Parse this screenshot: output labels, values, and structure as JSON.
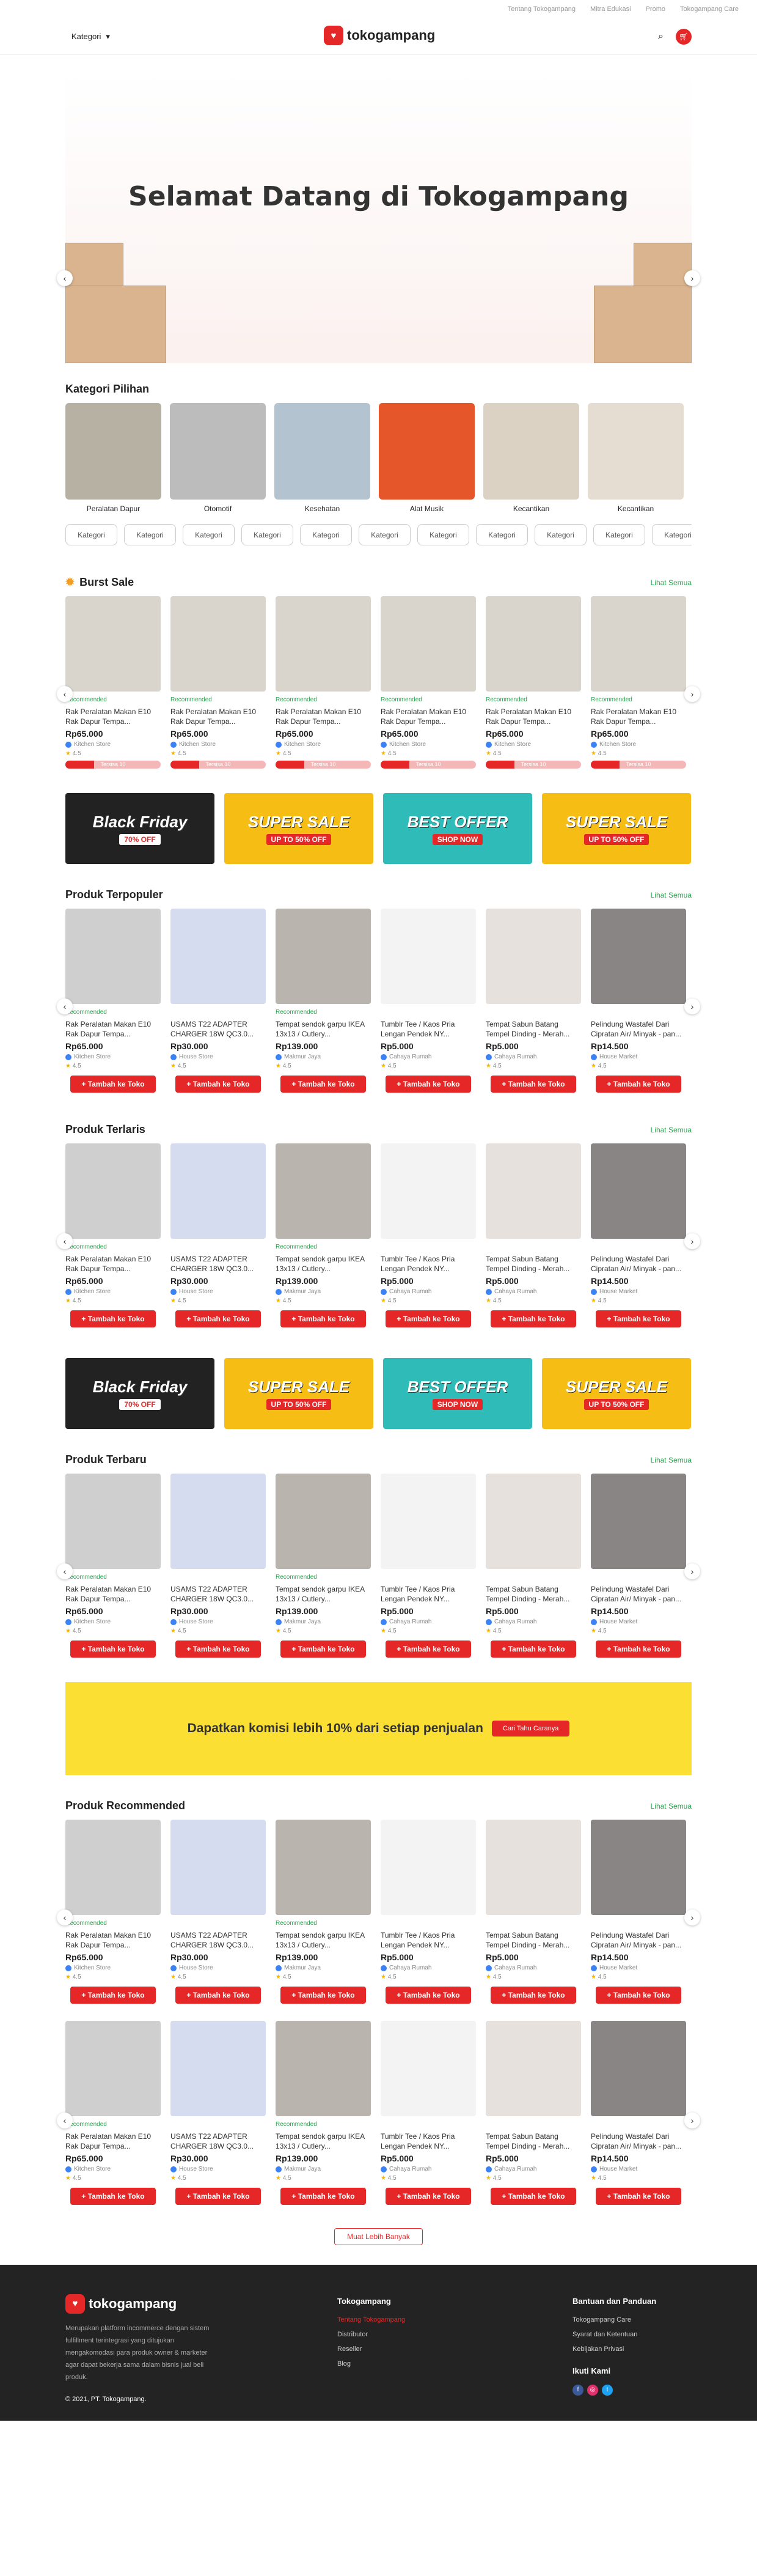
{
  "topbar": [
    "Tentang Tokogampang",
    "Mitra Edukasi",
    "Promo",
    "Tokogampang Care"
  ],
  "header": {
    "kategori": "Kategori",
    "logo": "tokogampang"
  },
  "hero": {
    "title": "Selamat Datang di Tokogampang"
  },
  "kategori": {
    "title": "Kategori Pilihan",
    "items": [
      {
        "label": "Peralatan Dapur",
        "color": "#b7b1a4"
      },
      {
        "label": "Otomotif",
        "color": "#bcbcbc"
      },
      {
        "label": "Kesehatan",
        "color": "#b3c3cf"
      },
      {
        "label": "Alat Musik",
        "color": "#e5562b"
      },
      {
        "label": "Kecantikan",
        "color": "#dbd2c3"
      },
      {
        "label": "Kecantikan",
        "color": "#e5ddd1"
      }
    ],
    "pills": [
      "Kategori",
      "Kategori",
      "Kategori",
      "Kategori",
      "Kategori",
      "Kategori",
      "Kategori",
      "Kategori",
      "Kategori",
      "Kategori",
      "Kategori"
    ]
  },
  "burst": {
    "title": "Burst Sale",
    "see_all": "Lihat Semua",
    "products": [
      {
        "badge": "Recommended",
        "name": "Rak Peralatan Makan E10 Rak Dapur Tempa...",
        "price": "Rp65.000",
        "shop": "Kitchen Store",
        "rating": "4.5",
        "bar": "Tersisa 10",
        "stock": 0.3
      },
      {
        "badge": "Recommended",
        "name": "Rak Peralatan Makan E10 Rak Dapur Tempa...",
        "price": "Rp65.000",
        "shop": "Kitchen Store",
        "rating": "4.5",
        "bar": "Tersisa 10",
        "stock": 0.3
      },
      {
        "badge": "Recommended",
        "name": "Rak Peralatan Makan E10 Rak Dapur Tempa...",
        "price": "Rp65.000",
        "shop": "Kitchen Store",
        "rating": "4.5",
        "bar": "Tersisa 10",
        "stock": 0.3
      },
      {
        "badge": "Recommended",
        "name": "Rak Peralatan Makan E10 Rak Dapur Tempa...",
        "price": "Rp65.000",
        "shop": "Kitchen Store",
        "rating": "4.5",
        "bar": "Tersisa 10",
        "stock": 0.3
      },
      {
        "badge": "Recommended",
        "name": "Rak Peralatan Makan E10 Rak Dapur Tempa...",
        "price": "Rp65.000",
        "shop": "Kitchen Store",
        "rating": "4.5",
        "bar": "Tersisa 10",
        "stock": 0.3
      },
      {
        "badge": "Recommended",
        "name": "Rak Peralatan Makan E10 Rak Dapur Tempa...",
        "price": "Rp65.000",
        "shop": "Kitchen Store",
        "rating": "4.5",
        "bar": "Tersisa 10",
        "stock": 0.3
      }
    ]
  },
  "banners": [
    {
      "type": "bf",
      "line1": "Black Friday",
      "line2": "70% OFF"
    },
    {
      "type": "ss",
      "line1": "SUPER SALE",
      "line2": "UP TO 50% OFF"
    },
    {
      "type": "bo",
      "line1": "BEST OFFER",
      "line2": "SHOP NOW"
    },
    {
      "type": "ss",
      "line1": "SUPER SALE",
      "line2": "UP TO 50% OFF"
    }
  ],
  "products": [
    {
      "badge": "Recommended",
      "name": "Rak Peralatan Makan E10 Rak Dapur Tempa...",
      "price": "Rp65.000",
      "shop": "Kitchen Store",
      "rating": "4.5",
      "color": "#cfcfcf"
    },
    {
      "badge": "",
      "name": "USAMS T22 ADAPTER CHARGER 18W QC3.0...",
      "price": "Rp30.000",
      "shop": "House Store",
      "rating": "4.5",
      "color": "#d6dcef"
    },
    {
      "badge": "Recommended",
      "name": "Tempat sendok garpu IKEA 13x13 / Cutlery...",
      "price": "Rp139.000",
      "shop": "Makmur Jaya",
      "rating": "4.5",
      "color": "#b9b4ad"
    },
    {
      "badge": "",
      "name": "Tumblr Tee / Kaos Pria Lengan Pendek NY...",
      "price": "Rp5.000",
      "shop": "Cahaya Rumah",
      "rating": "4.5",
      "color": "#f3f3f3"
    },
    {
      "badge": "",
      "name": "Tempat Sabun Batang Tempel Dinding - Merah...",
      "price": "Rp5.000",
      "shop": "Cahaya Rumah",
      "rating": "4.5",
      "color": "#e6e1dc"
    },
    {
      "badge": "",
      "name": "Pelindung Wastafel Dari Cipratan Air/ Minyak - pan...",
      "price": "Rp14.500",
      "shop": "House Market",
      "rating": "4.5",
      "color": "#8a8585"
    }
  ],
  "add_label": "+ Tambah ke Toko",
  "sections": {
    "terpopuler": "Produk Terpopuler",
    "terlaris": "Produk Terlaris",
    "terbaru": "Produk Terbaru",
    "recommended": "Produk Recommended",
    "see_all": "Lihat Semua"
  },
  "promo": {
    "text": "Dapatkan komisi lebih 10% dari setiap penjualan",
    "button": "Cari Tahu Caranya"
  },
  "more": "Muat Lebih Banyak",
  "footer": {
    "about": "Merupakan platform incommerce dengan sistem fulfillment terintegrasi yang ditujukan mengakomodasi para produk owner & marketer agar dapat bekerja sama dalam bisnis jual beli produk.",
    "copyright": "© 2021, PT. Tokogampang.",
    "col1_title": "Tokogampang",
    "col1": [
      "Tentang Tokogampang",
      "Distributor",
      "Reseller",
      "Blog"
    ],
    "col2_title": "Bantuan dan Panduan",
    "col2": [
      "Tokogampang Care",
      "Syarat dan Ketentuan",
      "Kebijakan Privasi"
    ],
    "social_title": "Ikuti Kami",
    "social": [
      {
        "name": "facebook-icon",
        "glyph": "f",
        "color": "#3b5998"
      },
      {
        "name": "instagram-icon",
        "glyph": "◎",
        "color": "#e1306c"
      },
      {
        "name": "twitter-icon",
        "glyph": "t",
        "color": "#1da1f2"
      }
    ],
    "accent": "#e62727"
  }
}
